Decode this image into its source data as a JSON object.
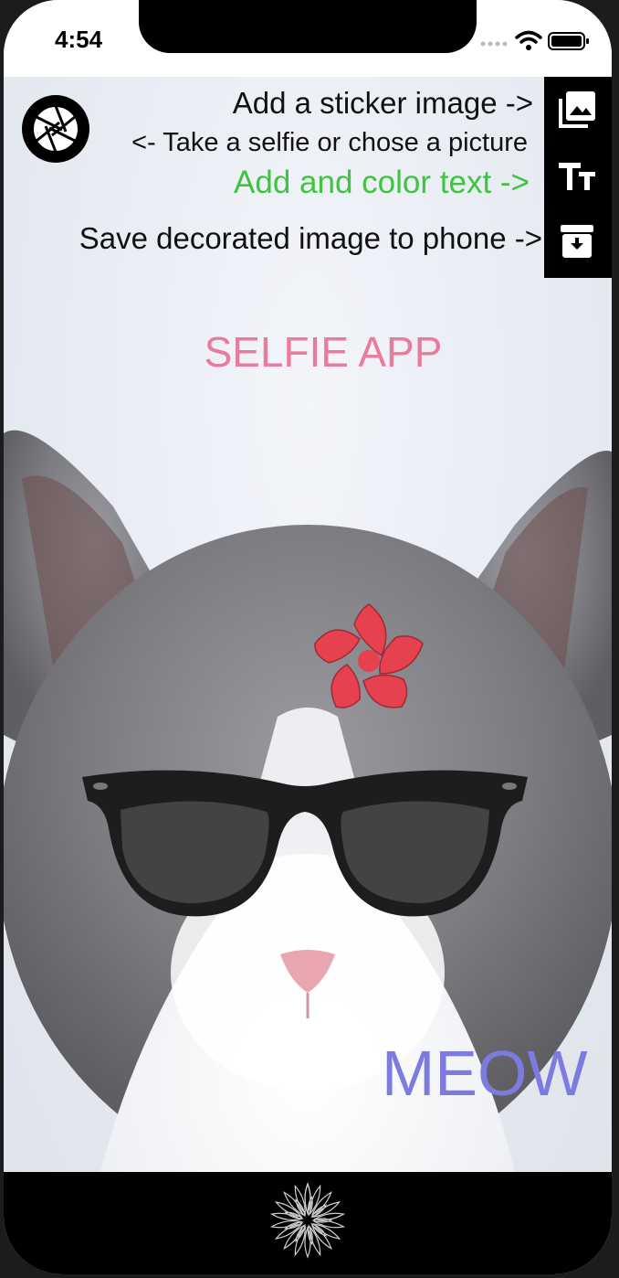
{
  "status_bar": {
    "time": "4:54",
    "signal_icon": "signal-dots-icon",
    "wifi_icon": "wifi-icon",
    "battery_icon": "battery-icon"
  },
  "hints": {
    "sticker": "Add a sticker image ->",
    "selfie": "<- Take a selfie or chose a picture",
    "text": "Add and color text ->",
    "save": "Save decorated image to phone ->"
  },
  "toolbar": {
    "sticker_icon": "photo-gallery-icon",
    "text_icon": "text-size-icon",
    "save_icon": "save-download-icon",
    "camera_icon": "camera-aperture-icon"
  },
  "overlay_text": {
    "title": "SELFIE APP",
    "meow": "MEOW"
  },
  "stickers": {
    "flower": "red-flower-sticker",
    "glasses": "black-glasses-sticker"
  },
  "colors": {
    "title": "#e97b9c",
    "meow": "#7c7ce0",
    "text_hint": "#3fc43f",
    "flower": "#e5414f"
  },
  "bottom_bar": {
    "icon": "flower-pattern-icon"
  }
}
